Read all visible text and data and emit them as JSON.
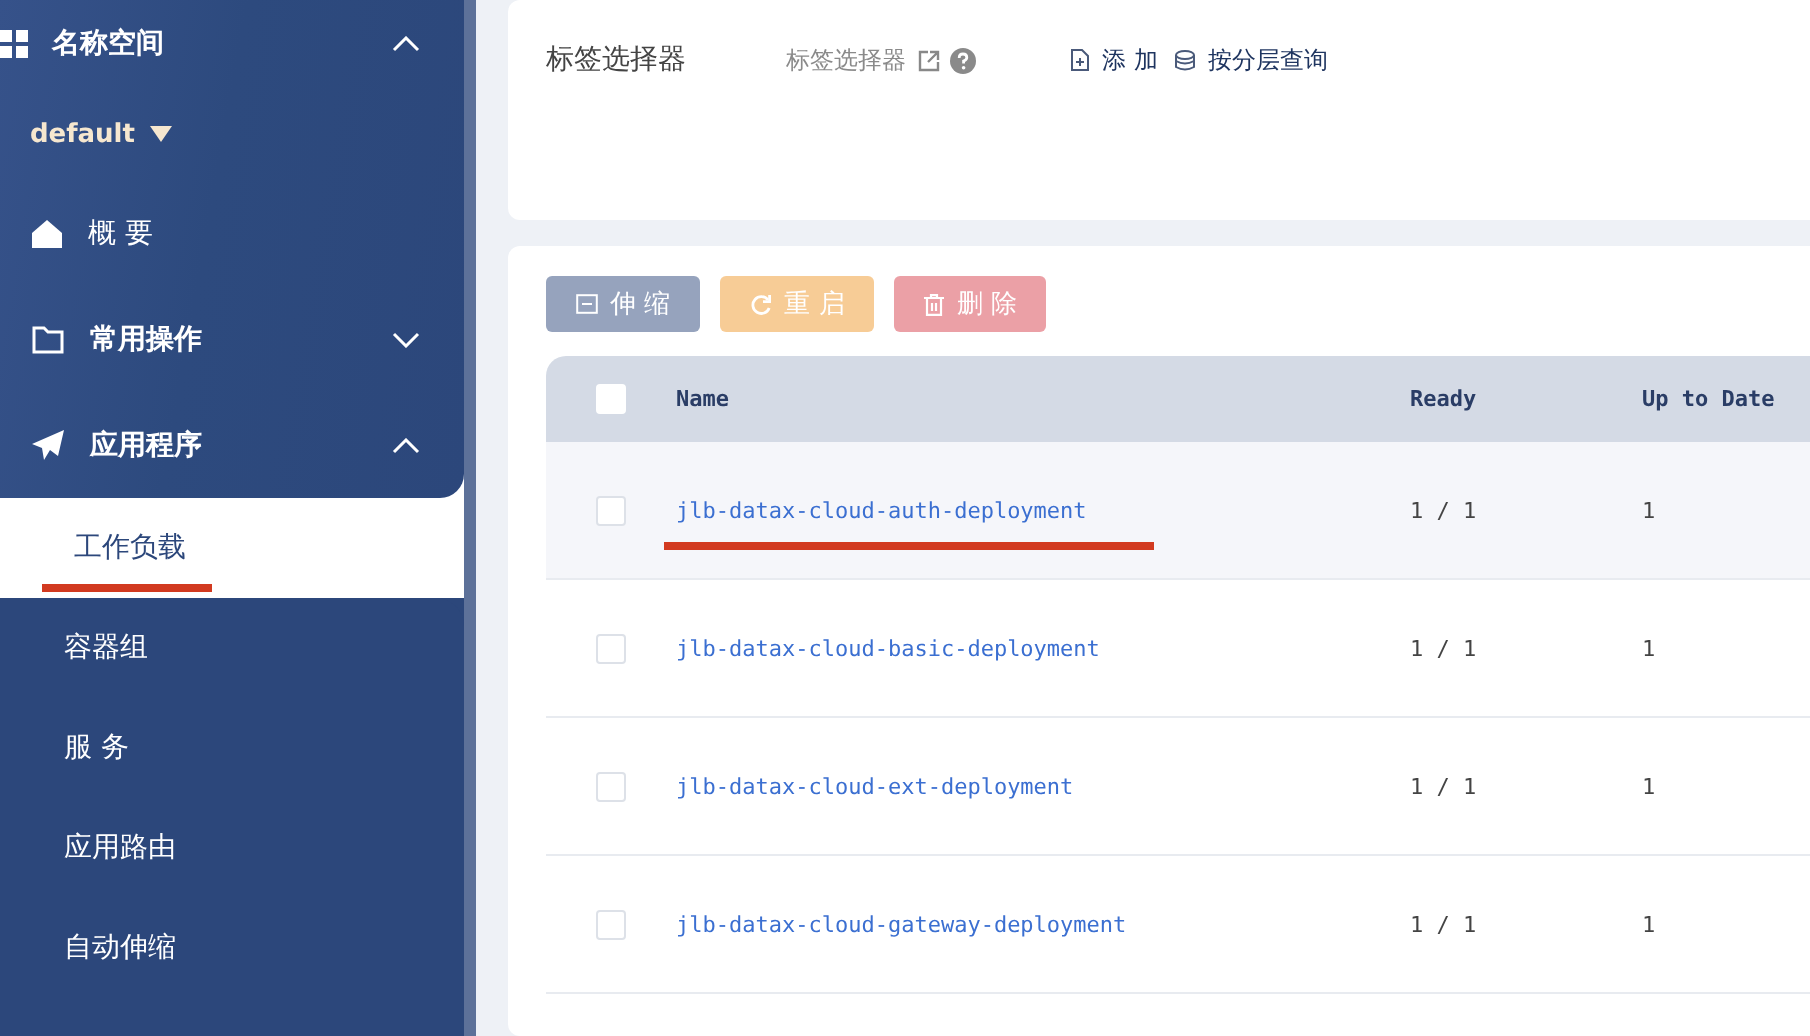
{
  "sidebar": {
    "namespace": {
      "label": "名称空间",
      "expanded": true
    },
    "namespace_select": {
      "value": "default"
    },
    "items": [
      {
        "kind": "link",
        "label": "概 要"
      },
      {
        "kind": "group",
        "label": "常用操作",
        "expanded": false
      },
      {
        "kind": "group",
        "label": "应用程序",
        "expanded": true,
        "children": [
          {
            "label": "工作负载",
            "selected": true,
            "highlighted": true
          },
          {
            "label": "容器组",
            "selected": false,
            "highlighted": false
          },
          {
            "label": "服 务",
            "selected": false,
            "highlighted": false
          },
          {
            "label": "应用路由",
            "selected": false,
            "highlighted": false
          },
          {
            "label": "自动伸缩",
            "selected": false,
            "highlighted": false
          }
        ]
      }
    ]
  },
  "filter": {
    "label": "标签选择器",
    "link": "标签选择器",
    "add": "添 加",
    "query": "按分层查询"
  },
  "actions": [
    {
      "kind": "scale",
      "label": "伸 缩",
      "disabled": true
    },
    {
      "kind": "restart",
      "label": "重 启",
      "disabled": true
    },
    {
      "kind": "delete",
      "label": "删 除",
      "disabled": true
    }
  ],
  "table": {
    "select_all": false,
    "columns": [
      "Name",
      "Ready",
      "Up to Date"
    ],
    "rows": [
      {
        "checked": false,
        "highlighted": true,
        "cells": [
          "jlb-datax-cloud-auth-deployment",
          "1 / 1",
          "1"
        ]
      },
      {
        "checked": false,
        "highlighted": false,
        "cells": [
          "jlb-datax-cloud-basic-deployment",
          "1 / 1",
          "1"
        ]
      },
      {
        "checked": false,
        "highlighted": false,
        "cells": [
          "jlb-datax-cloud-ext-deployment",
          "1 / 1",
          "1"
        ]
      },
      {
        "checked": false,
        "highlighted": false,
        "cells": [
          "jlb-datax-cloud-gateway-deployment",
          "1 / 1",
          "1"
        ]
      }
    ]
  }
}
